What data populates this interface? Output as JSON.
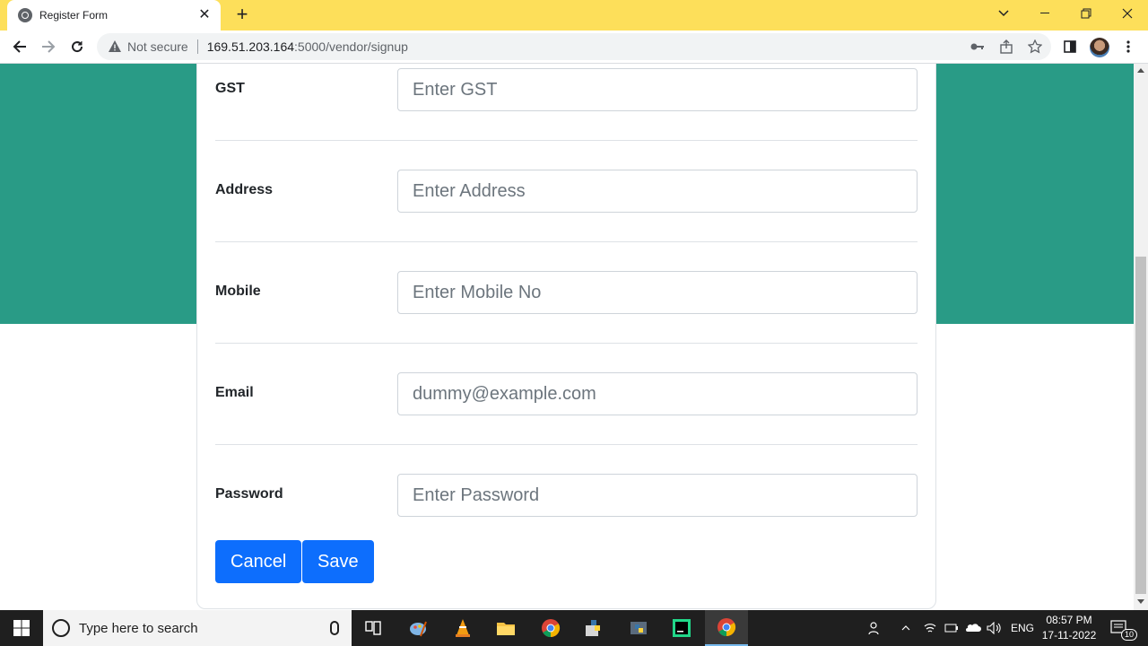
{
  "browser": {
    "tab_title": "Register Form",
    "tab_close": "✕",
    "new_tab": "+",
    "security_label": "Not secure",
    "url_host": "169.51.203.164",
    "url_path": ":5000/vendor/signup"
  },
  "form": {
    "fields": [
      {
        "label": "GST",
        "placeholder": "Enter GST"
      },
      {
        "label": "Address",
        "placeholder": "Enter Address"
      },
      {
        "label": "Mobile",
        "placeholder": "Enter Mobile No"
      },
      {
        "label": "Email",
        "placeholder": "dummy@example.com"
      },
      {
        "label": "Password",
        "placeholder": "Enter Password"
      }
    ],
    "cancel_label": "Cancel",
    "save_label": "Save"
  },
  "colors": {
    "banner": "#299b86",
    "primary_button": "#0d6efd",
    "titlebar": "#fddf5a"
  },
  "taskbar": {
    "search_placeholder": "Type here to search",
    "language": "ENG",
    "time": "08:57 PM",
    "date": "17-11-2022",
    "notification_count": "10"
  }
}
